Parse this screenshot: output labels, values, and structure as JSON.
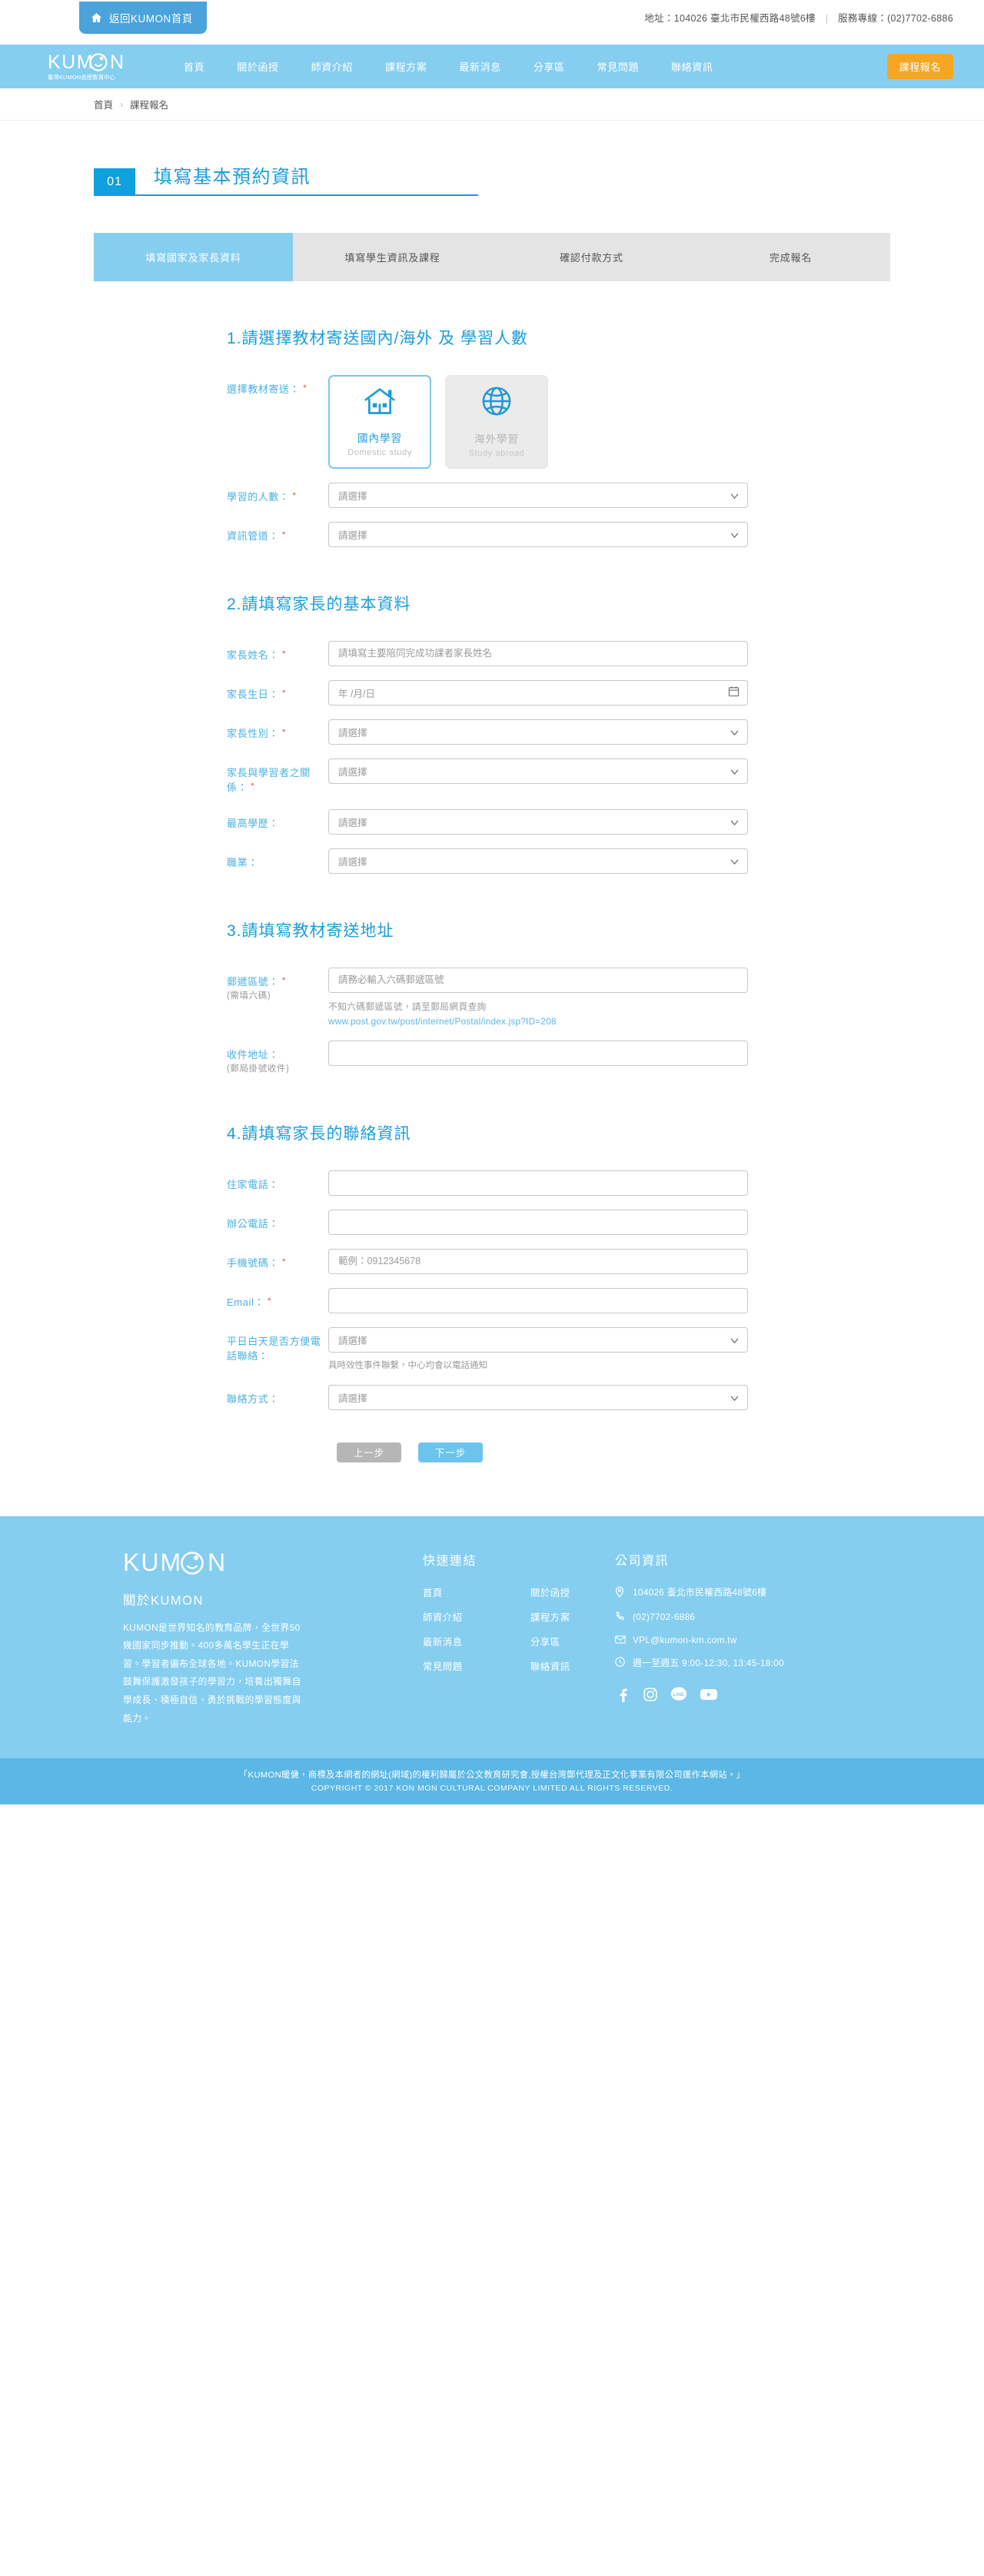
{
  "topbar": {
    "home_button": "返回KUMON首頁",
    "home_icon": "home-icon",
    "address": "地址：104026 臺北市民權西路48號6樓",
    "hotline": "服務專線：(02)7702-6886"
  },
  "nav": {
    "logo_text": "KUMON",
    "logo_sub": "臺灣KUMON函授教育中心",
    "items": [
      {
        "label": "首頁"
      },
      {
        "label": "關於函授"
      },
      {
        "label": "師資介紹"
      },
      {
        "label": "課程方案"
      },
      {
        "label": "最新消息"
      },
      {
        "label": "分享區"
      },
      {
        "label": "常見問題"
      },
      {
        "label": "聯絡資訊"
      }
    ],
    "cta": "課程報名"
  },
  "breadcrumb": {
    "home": "首頁",
    "chevron": "›",
    "current": "課程報名"
  },
  "step": {
    "number": "01",
    "title": "填寫基本預約資訊"
  },
  "tabs": [
    {
      "label": "填寫國家及家長資料",
      "active": true
    },
    {
      "label": "填寫學生資訊及課程",
      "active": false
    },
    {
      "label": "確認付款方式",
      "active": false
    },
    {
      "label": "完成報名",
      "active": false
    }
  ],
  "section1": {
    "title": "1.請選擇教材寄送國內/海外 及 學習人數",
    "ship_label": "選擇教材寄送：",
    "cards": [
      {
        "name": "國內學習",
        "en": "Domestic study",
        "icon": "house-icon",
        "selected": true
      },
      {
        "name": "海外學習",
        "en": "Study abroad",
        "icon": "globe-icon",
        "selected": false
      }
    ],
    "count_label": "學習的人數：",
    "count_value": "請選擇",
    "channel_label": "資訊管道：",
    "channel_value": "請選擇"
  },
  "section2": {
    "title": "2.請填寫家長的基本資料",
    "name_label": "家長姓名：",
    "name_placeholder": "請填寫主要陪同完成功課者家長姓名",
    "birth_label": "家長生日：",
    "birth_placeholder": "年 /月/日",
    "gender_label": "家長性別：",
    "gender_value": "請選擇",
    "relation_label": "家長與學習者之關係：",
    "relation_value": "請選擇",
    "education_label": "最高學歷：",
    "education_value": "請選擇",
    "job_label": "職業：",
    "job_value": "請選擇"
  },
  "section3": {
    "title": "3.請填寫教材寄送地址",
    "zip_label": "郵遞區號：",
    "zip_sub": "(需填六碼)",
    "zip_placeholder": "請務必輸入六碼郵遞區號",
    "zip_hint": "不知六碼郵遞區號，請至郵局網頁查詢",
    "zip_link": "www.post.gov.tw/post/internet/Postal/index.jsp?ID=208",
    "addr_label": "收件地址：",
    "addr_sub": "(郵局掛號收件)",
    "addr_value": ""
  },
  "section4": {
    "title": "4.請填寫家長的聯絡資訊",
    "home_phone_label": "住家電話：",
    "home_phone_value": "",
    "office_phone_label": "辦公電話：",
    "office_phone_value": "",
    "mobile_label": "手機號碼：",
    "mobile_placeholder": "範例：0912345678",
    "email_label": "Email：",
    "email_value": "",
    "weekday_label": "平日白天是否方便電話聯絡：",
    "weekday_value": "請選擇",
    "weekday_note": "具時效性事件聯繫，中心均會以電話通知",
    "contact_label": "聯絡方式：",
    "contact_value": "請選擇"
  },
  "buttons": {
    "prev": "上一步",
    "next": "下一步"
  },
  "footer": {
    "logo_text": "KUMON",
    "about_title": "關於KUMON",
    "about_text": "KUMON是世界知名的教育品牌，全世界50幾國家同步推動。400多萬名學生正在學習。學習者遍布全球各地。KUMON學習法鼓舞保護激發孩子的學習力，培養出獨舞自學成長、積極自信、勇於挑戰的學習態度與能力。",
    "links_title": "快速連結",
    "links": [
      {
        "label": "首頁"
      },
      {
        "label": "關於函授"
      },
      {
        "label": "師資介紹"
      },
      {
        "label": "課程方案"
      },
      {
        "label": "最新消息"
      },
      {
        "label": "分享區"
      },
      {
        "label": "常見問題"
      },
      {
        "label": "聯絡資訊"
      }
    ],
    "info_title": "公司資訊",
    "info": [
      {
        "icon": "map-pin-icon",
        "text": "104026 臺北市民權西路48號6樓"
      },
      {
        "icon": "phone-icon",
        "text": "(02)7702-6886"
      },
      {
        "icon": "mail-icon",
        "text": "VPL@kumon-km.com.tw"
      },
      {
        "icon": "clock-icon",
        "text": "週一至週五 9:00-12:30, 13:45-18:00"
      }
    ],
    "social": [
      {
        "icon": "facebook-icon",
        "glyph": "f"
      },
      {
        "icon": "instagram-icon",
        "glyph": "◻"
      },
      {
        "icon": "line-icon",
        "glyph": "LINE"
      },
      {
        "icon": "youtube-icon",
        "glyph": "▶"
      }
    ]
  },
  "copyright": {
    "line1": "「KUMON暖傭，商標及本網者的網址(網域)的權利歸屬於公文教育研究會,授權台灣鄭代理及正文化事業有限公司運作本網站。」",
    "line2": "COPYRIGHT © 2017 KON MON CULTURAL COMPANY LIMITED ALL RIGHTS RESERVED."
  },
  "colors": {
    "brand_blue": "#85cef0",
    "accent_blue": "#1b9dd9",
    "cta_orange": "#f5a623",
    "required_red": "#e8453c"
  }
}
